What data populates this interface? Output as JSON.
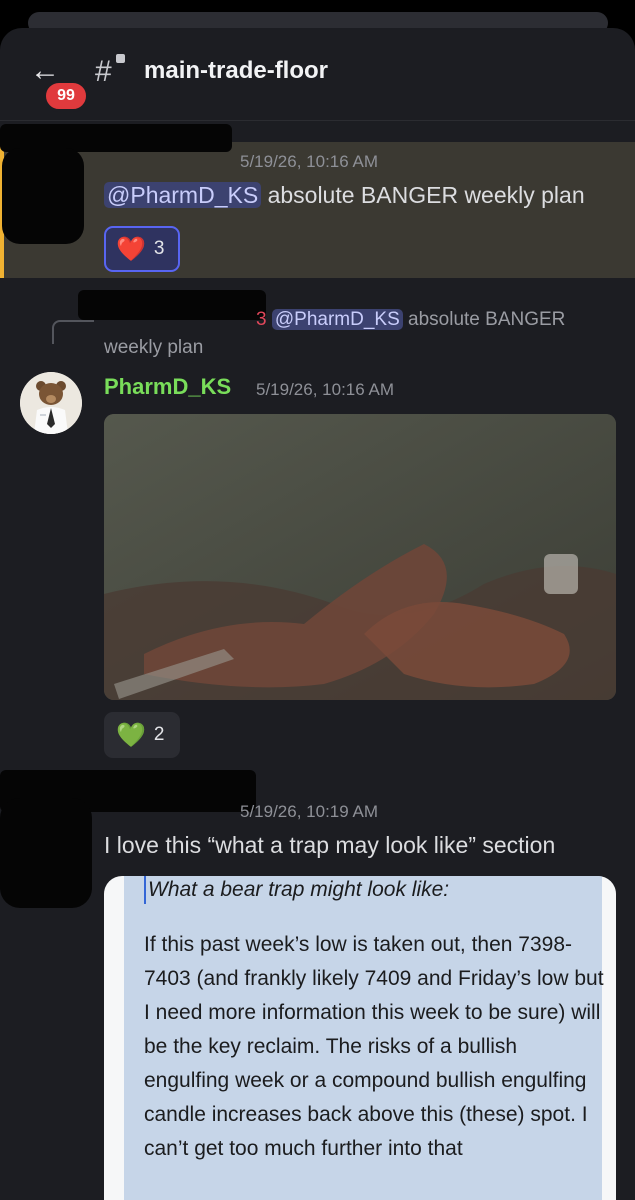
{
  "header": {
    "back_glyph": "←",
    "unread_badge": "99",
    "hash_glyph": "#",
    "channel_name": "main-trade-floor"
  },
  "messages": [
    {
      "timestamp": "5/19/26, 10:16 AM",
      "mention": "@PharmD_KS",
      "text": " absolute BANGER weekly plan",
      "reaction": {
        "emoji": "❤️",
        "count": "3"
      }
    },
    {
      "reply_suffix": "3",
      "reply_mention": "@PharmD_KS",
      "reply_text": " absolute BANGER weekly plan",
      "author": "PharmD_KS",
      "timestamp": "5/19/26, 10:16 AM",
      "reaction": {
        "emoji": "💚",
        "count": "2"
      }
    },
    {
      "timestamp": "5/19/26, 10:19 AM",
      "text": "I love this “what a trap may look like” section",
      "quote_title": "What a bear trap might look like:",
      "quote_body": "If this past week’s low is taken out, then 7398-7403 (and frankly likely 7409 and Friday’s low but I need more information this week to be sure) will be the key reclaim. The risks of a bullish engulfing week or a compound bullish engulfing candle increases back above this (these) spot. I can’t get too much further into that"
    }
  ],
  "colors": {
    "app_bg": "#1c1d22",
    "highlight_bg": "#3b3932",
    "highlight_bar": "#f0b232",
    "mention_bg": "#3c4270",
    "author_name": "#79dd5a",
    "badge_red": "#e03a3d",
    "quote_bg": "#c6d5e8"
  },
  "icons": [
    "back-arrow-icon",
    "locked-channel-icon"
  ]
}
